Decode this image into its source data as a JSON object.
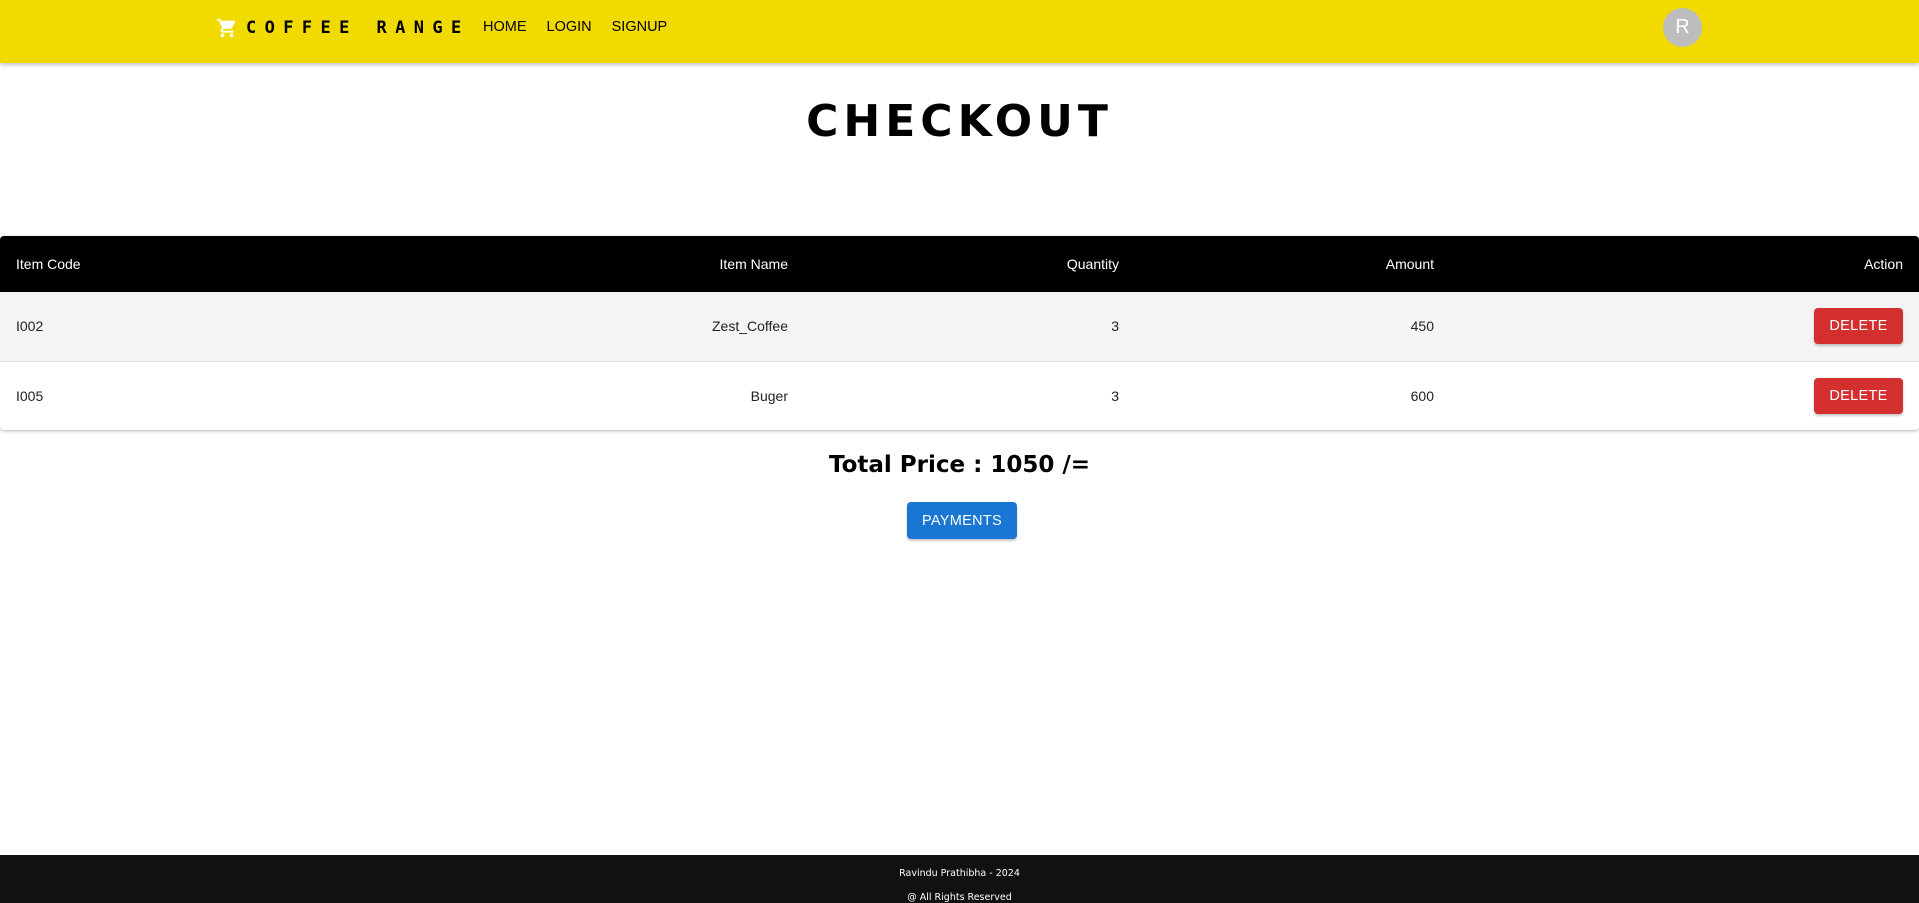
{
  "header": {
    "brand": "COFFEE RANGE",
    "brand_icon": "shopping-cart-icon",
    "background": "#f1da00",
    "nav": [
      {
        "label": "HOME"
      },
      {
        "label": "LOGIN"
      },
      {
        "label": "SIGNUP"
      }
    ],
    "avatar_initial": "R"
  },
  "page": {
    "title": "CHECKOUT"
  },
  "table": {
    "headers": {
      "code": "Item Code",
      "name": "Item Name",
      "quantity": "Quantity",
      "amount": "Amount",
      "action": "Action"
    },
    "rows": [
      {
        "code": "I002",
        "name": "Zest_Coffee",
        "quantity": "3",
        "amount": "450",
        "action": "DELETE"
      },
      {
        "code": "I005",
        "name": "Buger",
        "quantity": "3",
        "amount": "600",
        "action": "DELETE"
      }
    ]
  },
  "summary": {
    "total_text": "Total Price : 1050 /=",
    "payments_label": "PAYMENTS"
  },
  "footer": {
    "line1": "Ravindu Prathibha - 2024",
    "line2": "@ All Rights Reserved"
  },
  "colors": {
    "delete": "#d32f2f",
    "primary": "#1976d2",
    "footer": "#111111"
  }
}
